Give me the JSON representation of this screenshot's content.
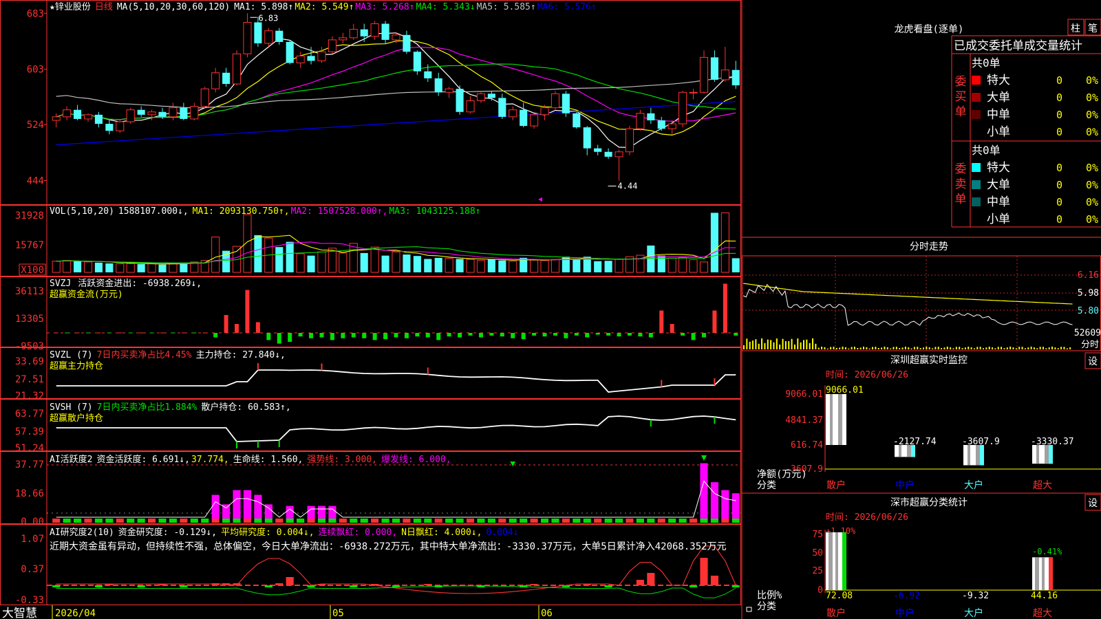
{
  "stock": {
    "star": "★",
    "name": "锌业股份",
    "period": "日线"
  },
  "colors": {
    "red": "#ff3232",
    "cyan": "#54fcfc",
    "green": "#00e000",
    "white": "#ffffff",
    "yellow": "#ffff00",
    "magenta": "#ff00ff",
    "blue": "#0000ff",
    "orange": "#ff8000"
  },
  "price_panel": {
    "ma_label": "MA(5,10,20,30,60,120)",
    "ma_items": [
      {
        "label": "MA1: 5.898↑",
        "color": "#ffffff"
      },
      {
        "label": "MA2: 5.549↑",
        "color": "#ffff00"
      },
      {
        "label": "MA3: 5.268↑",
        "color": "#ff00ff"
      },
      {
        "label": "MA4: 5.343↓",
        "color": "#00e000"
      },
      {
        "label": "MA5: 5.585↑",
        "color": "#c0c0c0"
      },
      {
        "label": "MA6: 5.576↑",
        "color": "#0000ff"
      }
    ],
    "y_ticks": [
      {
        "v": 6.83,
        "label": "683"
      },
      {
        "v": 6.03,
        "label": "603"
      },
      {
        "v": 5.24,
        "label": "524"
      },
      {
        "v": 4.44,
        "label": "444"
      }
    ],
    "ylim": [
      4.15,
      6.98
    ],
    "high_label": "6.83",
    "low_label": "4.44"
  },
  "volume_panel": {
    "label": "VOL(5,10,20)",
    "value": "1588107.000↓,",
    "items": [
      {
        "label": "MA1: 2093130.750↑,",
        "color": "#ffff00"
      },
      {
        "label": "MA2: 1507528.000↑,",
        "color": "#ff00ff"
      },
      {
        "label": "MA3: 1043125.188↑",
        "color": "#00e000"
      }
    ],
    "y_ticks": [
      "31928",
      "15767"
    ],
    "unit": "X100"
  },
  "svzj_panel": {
    "name": "SVZJ",
    "label": "活跃资金进出: -6938.269↓,",
    "subtitle": "超赢资金流(万元)",
    "y_ticks": [
      "36113",
      "13305",
      "-9503"
    ]
  },
  "svzl_panel": {
    "name": "SVZL (7)",
    "label1": "7日内买卖净占比4.45%",
    "label2": "主力持仓: 27.840↓,",
    "subtitle": "超赢主力持仓",
    "y_ticks": [
      "33.69",
      "27.51",
      "21.32"
    ]
  },
  "svsh_panel": {
    "name": "SVSH (7)",
    "label1": "7日内买卖净占比1.884%",
    "label2": "散户持仓: 60.583↑,",
    "subtitle": "超赢散户持仓",
    "y_ticks": [
      "63.77",
      "57.39",
      "51.24"
    ]
  },
  "ai_active_panel": {
    "name": "AI活跃度2",
    "label": "资金活跃度: 6.691↓,",
    "val2": "37.774,",
    "life": "生命线: 1.560,",
    "strong": "强势线: 3.000,",
    "burst": "爆发线: 6.000,",
    "y_ticks": [
      "37.77",
      "18.66",
      "0.00"
    ]
  },
  "ai_research_panel": {
    "name": "AI研究度2(10)",
    "label": "资金研究度: -0.129↓,",
    "avg": "平均研究度: 0.004↓,",
    "cont": "连续飘红: 0.000,",
    "nday": "N日飘红: 4.000↓,",
    "last": "0.004↓",
    "comment": "近期大资金虽有异动，但持续性不强，总体偏空，今日大单净流出：-6938.272万元，其中特大单净流出：-3330.37万元，大单5日累计净入42068.352万元",
    "y_ticks": [
      "1.07",
      "0.37",
      "-0.33"
    ]
  },
  "date_axis": {
    "brand": "大智慧",
    "labels": [
      "2026/04",
      "05",
      "06"
    ]
  },
  "dragon": {
    "title": "龙虎看盘(逐单)",
    "btn1": "柱",
    "btn2": "笔",
    "header": "已成交委托单成交量统计",
    "buy": {
      "side": "委买单",
      "total": "共0单",
      "rows": [
        {
          "name": "特大",
          "v": "0",
          "p": "0%",
          "color": "#ff0000"
        },
        {
          "name": "大单",
          "v": "0",
          "p": "0%",
          "color": "#a00000"
        },
        {
          "name": "中单",
          "v": "0",
          "p": "0%",
          "color": "#600000"
        },
        {
          "name": "小单",
          "v": "0",
          "p": "0%",
          "color": ""
        }
      ]
    },
    "sell": {
      "side": "委卖单",
      "total": "共0单",
      "rows": [
        {
          "name": "特大",
          "v": "0",
          "p": "0%",
          "color": "#00ffff"
        },
        {
          "name": "大单",
          "v": "0",
          "p": "0%",
          "color": "#008080"
        },
        {
          "name": "中单",
          "v": "0",
          "p": "0%",
          "color": "#006060"
        },
        {
          "name": "小单",
          "v": "0",
          "p": "0%",
          "color": ""
        }
      ]
    }
  },
  "intraday": {
    "title": "分时走势",
    "prices": [
      "6.16",
      "5.98",
      "5.80"
    ],
    "vol": "52609",
    "vol_label": "分时"
  },
  "sz_monitor": {
    "title": "深圳超赢实时监控",
    "set": "设",
    "time": "时间: 2026/06/26",
    "y_ticks": [
      "9066.01",
      "4841.37",
      "616.74",
      "-3607.9"
    ],
    "ylabel": "净额(万元)",
    "xlabel": "分类",
    "bars": [
      {
        "cat": "散户",
        "value": 9066.01,
        "label": "9066.01"
      },
      {
        "cat": "中户",
        "value": -2127.74,
        "label": "-2127.74"
      },
      {
        "cat": "大户",
        "value": -3607.9,
        "label": "-3607.9"
      },
      {
        "cat": "超大",
        "value": -3330.37,
        "label": "-3330.37"
      }
    ]
  },
  "sz_class": {
    "title": "深市超赢分类统计",
    "set": "设",
    "time": "时间: 2026/06/26",
    "y_ticks": [
      "75",
      "50",
      "25",
      "0"
    ],
    "ylabel": "比例%",
    "xlabel": "分类",
    "top_labels": [
      "+1.10%",
      "-0.41%"
    ],
    "bars": [
      {
        "cat": "散户",
        "value": 72.08,
        "label": "72.08"
      },
      {
        "cat": "中户",
        "value": 0,
        "label": "-6.92"
      },
      {
        "cat": "大户",
        "value": 0,
        "label": "-9.32"
      },
      {
        "cat": "超大",
        "value": 44.16,
        "label": "44.16"
      }
    ]
  },
  "chart_data": [
    {
      "type": "candlestick",
      "title": "锌业股份 日线",
      "ylim": [
        4.15,
        6.98
      ],
      "candles": [
        [
          5.3,
          5.4,
          5.2,
          5.35
        ],
        [
          5.35,
          5.5,
          5.3,
          5.45
        ],
        [
          5.45,
          5.52,
          5.3,
          5.32
        ],
        [
          5.32,
          5.4,
          5.28,
          5.38
        ],
        [
          5.38,
          5.42,
          5.2,
          5.25
        ],
        [
          5.25,
          5.3,
          5.1,
          5.15
        ],
        [
          5.15,
          5.3,
          5.12,
          5.28
        ],
        [
          5.28,
          5.48,
          5.25,
          5.45
        ],
        [
          5.45,
          5.5,
          5.35,
          5.38
        ],
        [
          5.38,
          5.45,
          5.3,
          5.42
        ],
        [
          5.42,
          5.48,
          5.32,
          5.35
        ],
        [
          5.35,
          5.55,
          5.3,
          5.48
        ],
        [
          5.48,
          5.55,
          5.3,
          5.32
        ],
        [
          5.32,
          5.55,
          5.3,
          5.5
        ],
        [
          5.5,
          5.78,
          5.48,
          5.75
        ],
        [
          5.75,
          6.05,
          5.7,
          5.98
        ],
        [
          5.98,
          6.05,
          5.78,
          5.82
        ],
        [
          5.82,
          6.3,
          5.8,
          6.25
        ],
        [
          6.25,
          6.83,
          6.2,
          6.7
        ],
        [
          6.7,
          6.78,
          6.35,
          6.4
        ],
        [
          6.4,
          6.62,
          6.35,
          6.58
        ],
        [
          6.58,
          6.62,
          6.38,
          6.42
        ],
        [
          6.42,
          6.45,
          6.1,
          6.12
        ],
        [
          6.12,
          6.28,
          6.05,
          6.22
        ],
        [
          6.22,
          6.35,
          6.1,
          6.15
        ],
        [
          6.15,
          6.35,
          6.12,
          6.28
        ],
        [
          6.28,
          6.5,
          6.25,
          6.45
        ],
        [
          6.45,
          6.55,
          6.4,
          6.48
        ],
        [
          6.48,
          6.68,
          6.45,
          6.6
        ],
        [
          6.6,
          6.68,
          6.42,
          6.5
        ],
        [
          6.5,
          6.72,
          6.45,
          6.68
        ],
        [
          6.68,
          6.72,
          6.4,
          6.45
        ],
        [
          6.45,
          6.55,
          6.4,
          6.52
        ],
        [
          6.52,
          6.58,
          6.25,
          6.28
        ],
        [
          6.28,
          6.3,
          5.95,
          6.0
        ],
        [
          6.0,
          6.1,
          5.85,
          5.9
        ],
        [
          5.9,
          5.98,
          5.65,
          5.7
        ],
        [
          5.7,
          5.78,
          5.62,
          5.75
        ],
        [
          5.75,
          5.8,
          5.38,
          5.42
        ],
        [
          5.42,
          5.65,
          5.4,
          5.58
        ],
        [
          5.58,
          5.7,
          5.55,
          5.68
        ],
        [
          5.68,
          5.72,
          5.58,
          5.62
        ],
        [
          5.62,
          5.68,
          5.32,
          5.35
        ],
        [
          5.35,
          5.5,
          5.3,
          5.45
        ],
        [
          5.45,
          5.55,
          5.2,
          5.22
        ],
        [
          5.22,
          5.4,
          5.18,
          5.38
        ],
        [
          5.38,
          5.52,
          5.3,
          5.48
        ],
        [
          5.48,
          5.72,
          5.45,
          5.68
        ],
        [
          5.68,
          5.72,
          5.35,
          5.4
        ],
        [
          5.4,
          5.42,
          5.18,
          5.2
        ],
        [
          5.2,
          5.22,
          4.8,
          4.9
        ],
        [
          4.9,
          4.95,
          4.8,
          4.85
        ],
        [
          4.85,
          4.9,
          4.75,
          4.78
        ],
        [
          4.78,
          4.88,
          4.44,
          4.85
        ],
        [
          4.85,
          5.22,
          4.8,
          5.18
        ],
        [
          5.18,
          5.45,
          5.15,
          5.4
        ],
        [
          5.4,
          5.48,
          5.25,
          5.3
        ],
        [
          5.3,
          5.35,
          5.15,
          5.18
        ],
        [
          5.18,
          5.3,
          5.1,
          5.25
        ],
        [
          5.25,
          5.72,
          5.2,
          5.7
        ],
        [
          5.7,
          5.75,
          5.6,
          5.7
        ],
        [
          5.7,
          6.3,
          5.68,
          6.2
        ],
        [
          6.2,
          6.3,
          5.85,
          5.88
        ],
        [
          5.88,
          6.35,
          5.85,
          6.02
        ],
        [
          6.02,
          6.15,
          5.75,
          5.8
        ]
      ]
    }
  ]
}
